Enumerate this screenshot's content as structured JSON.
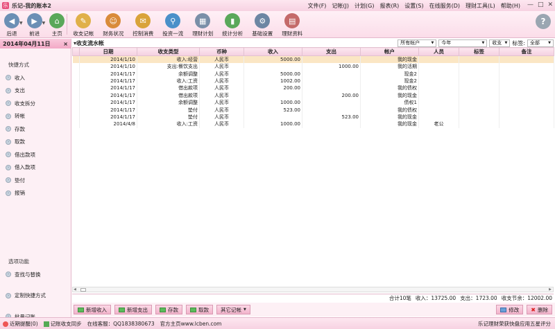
{
  "window": {
    "title": "乐记-我的账本2"
  },
  "menu": [
    "文件(F)",
    "记帐(J)",
    "计划(G)",
    "报表(R)",
    "设置(S)",
    "在线服务(D)",
    "理财工具(L)",
    "帮助(H)"
  ],
  "window_buttons": [
    "—",
    "□",
    "✕"
  ],
  "toolbar": {
    "back": "后退",
    "forward": "前进",
    "home": "主页",
    "items": [
      "收支记帐",
      "财务状况",
      "控制消费",
      "投资一流",
      "理财计划",
      "统计分析",
      "基础设置",
      "理财资料"
    ],
    "help": "?"
  },
  "sidebar": {
    "date": "2014年04月11日",
    "close": "×",
    "quick_title": "快捷方式",
    "quick_items": [
      "收入",
      "支出",
      "收支拆分",
      "转帐",
      "存款",
      "取款",
      "借出款项",
      "借入款项",
      "垫付",
      "报销"
    ],
    "options_title": "选项功能",
    "option_items": [
      "查找与替换",
      "定制快捷方式",
      "批量记账"
    ]
  },
  "main": {
    "title": "收支流水帐",
    "filters": {
      "account": "所有帐户",
      "period": "今年",
      "type": "收支",
      "tag_label": "标签:",
      "tag": "全部"
    },
    "columns": [
      "",
      "日期",
      "收支类型",
      "币种",
      "收入",
      "支出",
      "帐户",
      "人员",
      "标签",
      "备注"
    ],
    "rows": [
      {
        "date": "2014/1/10",
        "type": "收入:经营",
        "currency": "人民币",
        "income": "5000.00",
        "expense": "",
        "account": "我的现金",
        "person": "",
        "tag": "",
        "note": ""
      },
      {
        "date": "2014/1/10",
        "type": "支出:餐饮支出",
        "currency": "人民币",
        "income": "",
        "expense": "1000.00",
        "account": "我的活期",
        "person": "",
        "tag": "",
        "note": ""
      },
      {
        "date": "2014/1/17",
        "type": "余额调整",
        "currency": "人民币",
        "income": "5000.00",
        "expense": "",
        "account": "现金2",
        "person": "",
        "tag": "",
        "note": ""
      },
      {
        "date": "2014/1/17",
        "type": "收入:工资",
        "currency": "人民币",
        "income": "1002.00",
        "expense": "",
        "account": "现金2",
        "person": "",
        "tag": "",
        "note": ""
      },
      {
        "date": "2014/1/17",
        "type": "借出款项",
        "currency": "人民币",
        "income": "200.00",
        "expense": "",
        "account": "我的债权",
        "person": "",
        "tag": "",
        "note": ""
      },
      {
        "date": "2014/1/17",
        "type": "借出款项",
        "currency": "人民币",
        "income": "",
        "expense": "200.00",
        "account": "我的现金",
        "person": "",
        "tag": "",
        "note": ""
      },
      {
        "date": "2014/1/17",
        "type": "余额调整",
        "currency": "人民币",
        "income": "1000.00",
        "expense": "",
        "account": "债权1",
        "person": "",
        "tag": "",
        "note": ""
      },
      {
        "date": "2014/1/17",
        "type": "垫付",
        "currency": "人民币",
        "income": "523.00",
        "expense": "",
        "account": "我的债权",
        "person": "",
        "tag": "",
        "note": ""
      },
      {
        "date": "2014/1/17",
        "type": "垫付",
        "currency": "人民币",
        "income": "",
        "expense": "523.00",
        "account": "我的现金",
        "person": "",
        "tag": "",
        "note": ""
      },
      {
        "date": "2014/4/8",
        "type": "收入:工资",
        "currency": "人民币",
        "income": "1000.00",
        "expense": "",
        "account": "我的现金",
        "person": "老公",
        "tag": "",
        "note": ""
      }
    ],
    "totals": {
      "count": "合计10笔",
      "income": "收入：13725.00",
      "expense": "支出：1723.00",
      "balance": "收支节余：12002.00"
    }
  },
  "bottom_buttons": {
    "add_income": "新增收入",
    "add_expense": "新增支出",
    "deposit": "存款",
    "withdraw": "取款",
    "other": "其它记帐",
    "edit": "修改",
    "delete": "删除"
  },
  "status": {
    "reminder": "近期提醒(0)",
    "sync": "记账收支同步",
    "service": "在线客服：QQ1838380673",
    "site": "官方主页www.lcben.com",
    "award": "乐记理财荣获快盘应用五星评分"
  },
  "colors": {
    "accent": "#f3a9c6",
    "selected_row": "#fbe6c4"
  }
}
